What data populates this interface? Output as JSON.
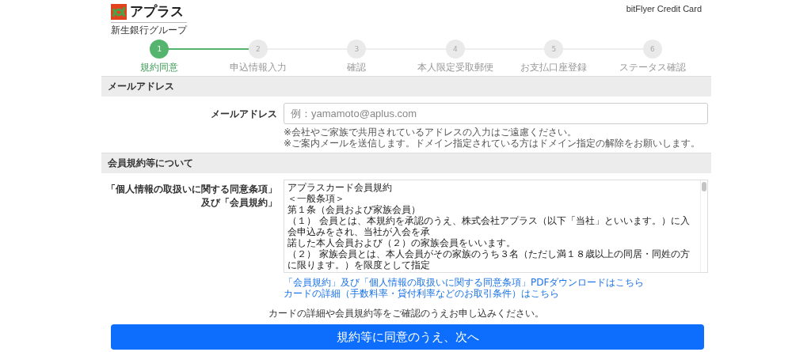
{
  "header": {
    "logo_text": "アプラス",
    "logo_subtext": "新生銀行グループ",
    "site_label": "bitFlyer Credit Card"
  },
  "steps": [
    {
      "number": "1",
      "label": "規約同意",
      "selected": true
    },
    {
      "number": "2",
      "label": "申込情報入力",
      "selected": false
    },
    {
      "number": "3",
      "label": "確認",
      "selected": false
    },
    {
      "number": "4",
      "label": "本人限定受取郵便",
      "selected": false
    },
    {
      "number": "5",
      "label": "お支払口座登録",
      "selected": false
    },
    {
      "number": "6",
      "label": "ステータス確認",
      "selected": false
    }
  ],
  "email_section": {
    "title": "メールアドレス",
    "label": "メールアドレス",
    "placeholder": "例：yamamoto@aplus.com",
    "notes": [
      "※会社やご家族で共用されているアドレスの入力はご遠慮ください。",
      "※ご案内メールを送信します。ドメイン指定されている方はドメイン指定の解除をお願いします。"
    ]
  },
  "terms_section": {
    "title": "会員規約等について",
    "label_lines": [
      "「個人情報の取扱いに関する同意条項」",
      "及び「会員規約」"
    ],
    "terms_lines": [
      "アプラスカード会員規約",
      "＜一般条項＞",
      "第１条（会員および家族会員）",
      "（１） 会員とは、本規約を承認のうえ、株式会社アプラス（以下「当社」といいます。）に入会申込みをされ、当社が入会を承",
      "諾した本人会員および（２）の家族会員をいいます。",
      "（２） 家族会員とは、本人会員がその家族のうち３名（ただし満１８歳以上の同居・同姓の方に限ります。）を限度として指定"
    ],
    "links": [
      "「会員規約」及び「個人情報の取扱いに関する同意条項」PDFダウンロードはこちら",
      "カードの詳細（手数料率・貸付利率などのお取引条件）はこちら"
    ]
  },
  "confirm_note": "カードの詳細や会員規約等をご確認のうえお申し込みください。",
  "submit_button": "規約等に同意のうえ、次へ"
}
